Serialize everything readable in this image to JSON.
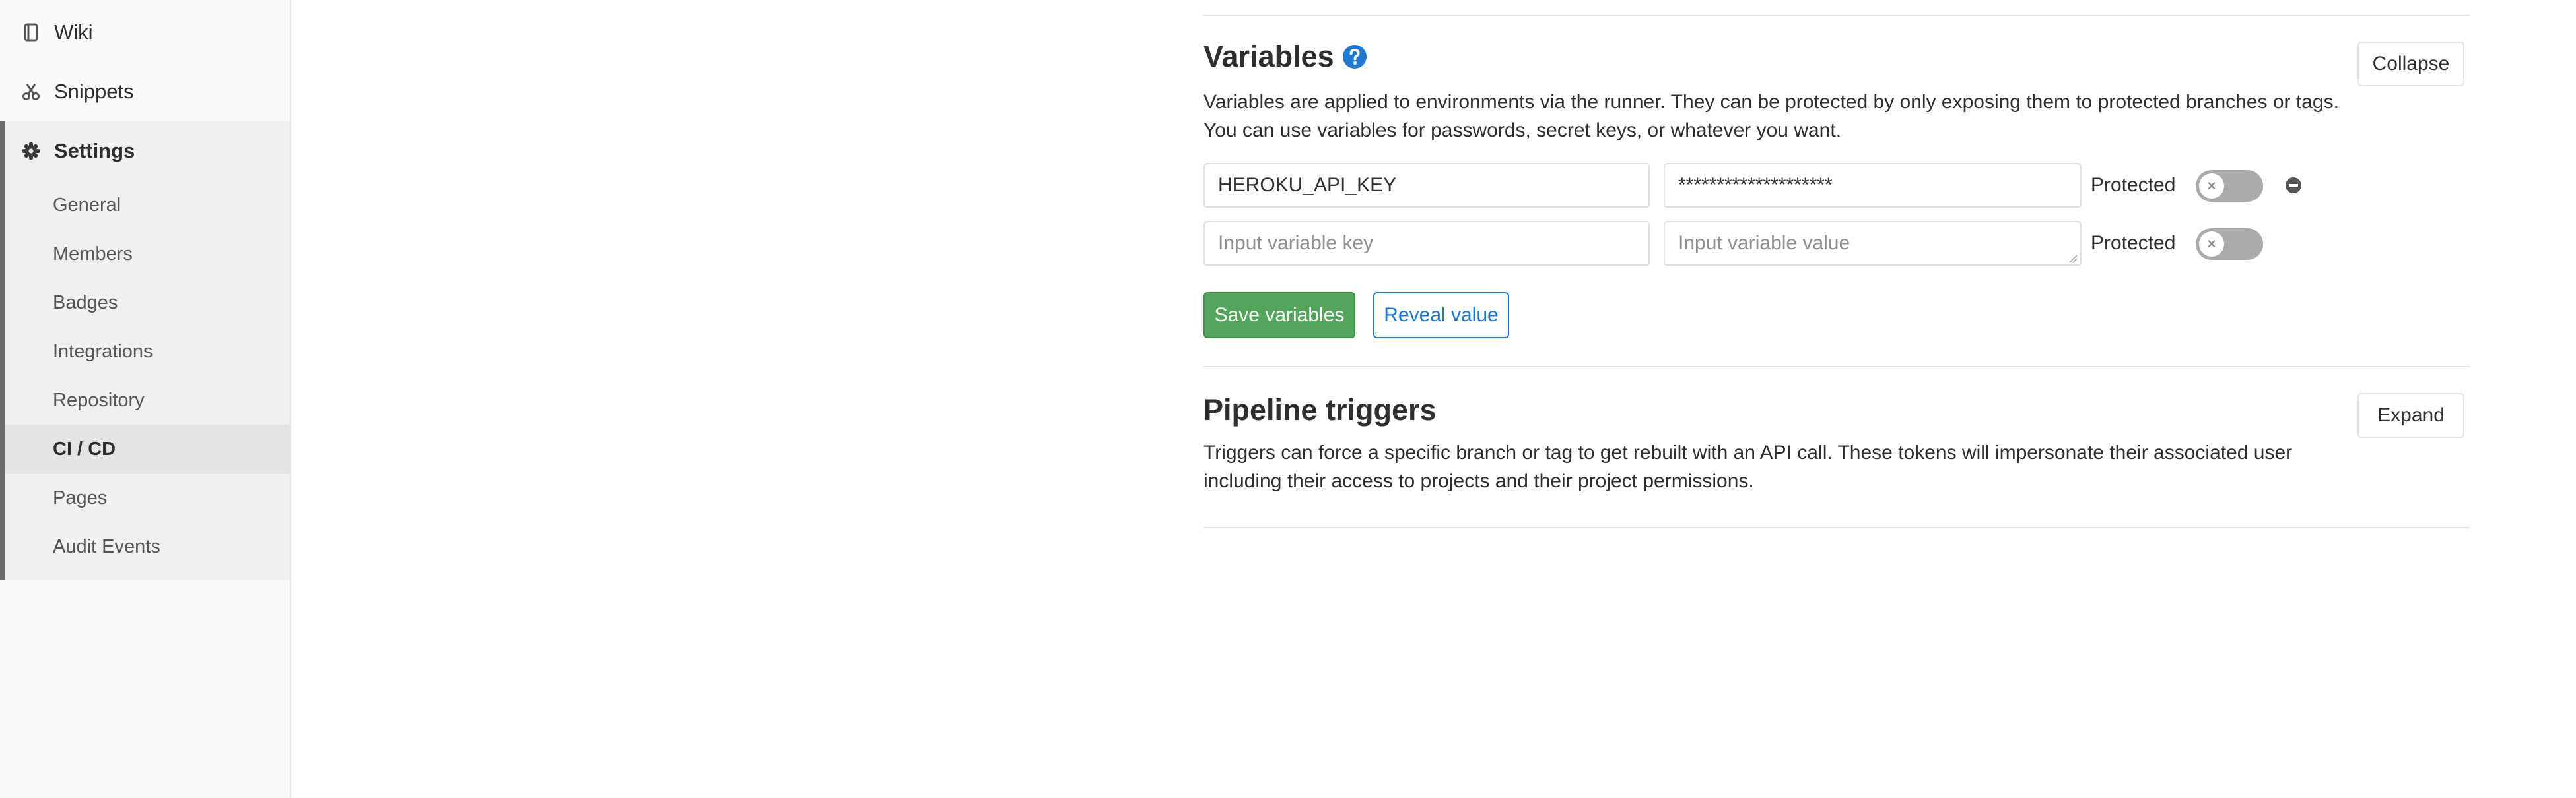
{
  "sidebar": {
    "top_items": [
      {
        "label": "Wiki",
        "icon": "book-icon"
      },
      {
        "label": "Snippets",
        "icon": "scissors-icon"
      }
    ],
    "settings": {
      "label": "Settings",
      "icon": "gear-icon",
      "items": [
        {
          "label": "General"
        },
        {
          "label": "Members"
        },
        {
          "label": "Badges"
        },
        {
          "label": "Integrations"
        },
        {
          "label": "Repository"
        },
        {
          "label": "CI / CD",
          "active": true
        },
        {
          "label": "Pages"
        },
        {
          "label": "Audit Events"
        }
      ]
    }
  },
  "variables": {
    "title": "Variables",
    "help_icon": "question-circle-icon",
    "description": "Variables are applied to environments via the runner. They can be protected by only exposing them to protected branches or tags. You can use variables for passwords, secret keys, or whatever you want.",
    "collapse_label": "Collapse",
    "rows": [
      {
        "key": "HEROKU_API_KEY",
        "value": "********************",
        "protected_label": "Protected",
        "protected": false
      },
      {
        "key": "",
        "value": "",
        "protected_label": "Protected",
        "protected": false
      }
    ],
    "key_placeholder": "Input variable key",
    "value_placeholder": "Input variable value",
    "toggle_off_glyph": "×",
    "save_label": "Save variables",
    "reveal_label": "Reveal value"
  },
  "pipeline_triggers": {
    "title": "Pipeline triggers",
    "description": "Triggers can force a specific branch or tag to get rebuilt with an API call. These tokens will impersonate their associated user including their access to projects and their project permissions.",
    "expand_label": "Expand"
  },
  "colors": {
    "success": "#52a55a",
    "link_blue": "#1f78d1",
    "toggle_off": "#ababab",
    "sidebar_active_border": "#6b6b6b"
  }
}
